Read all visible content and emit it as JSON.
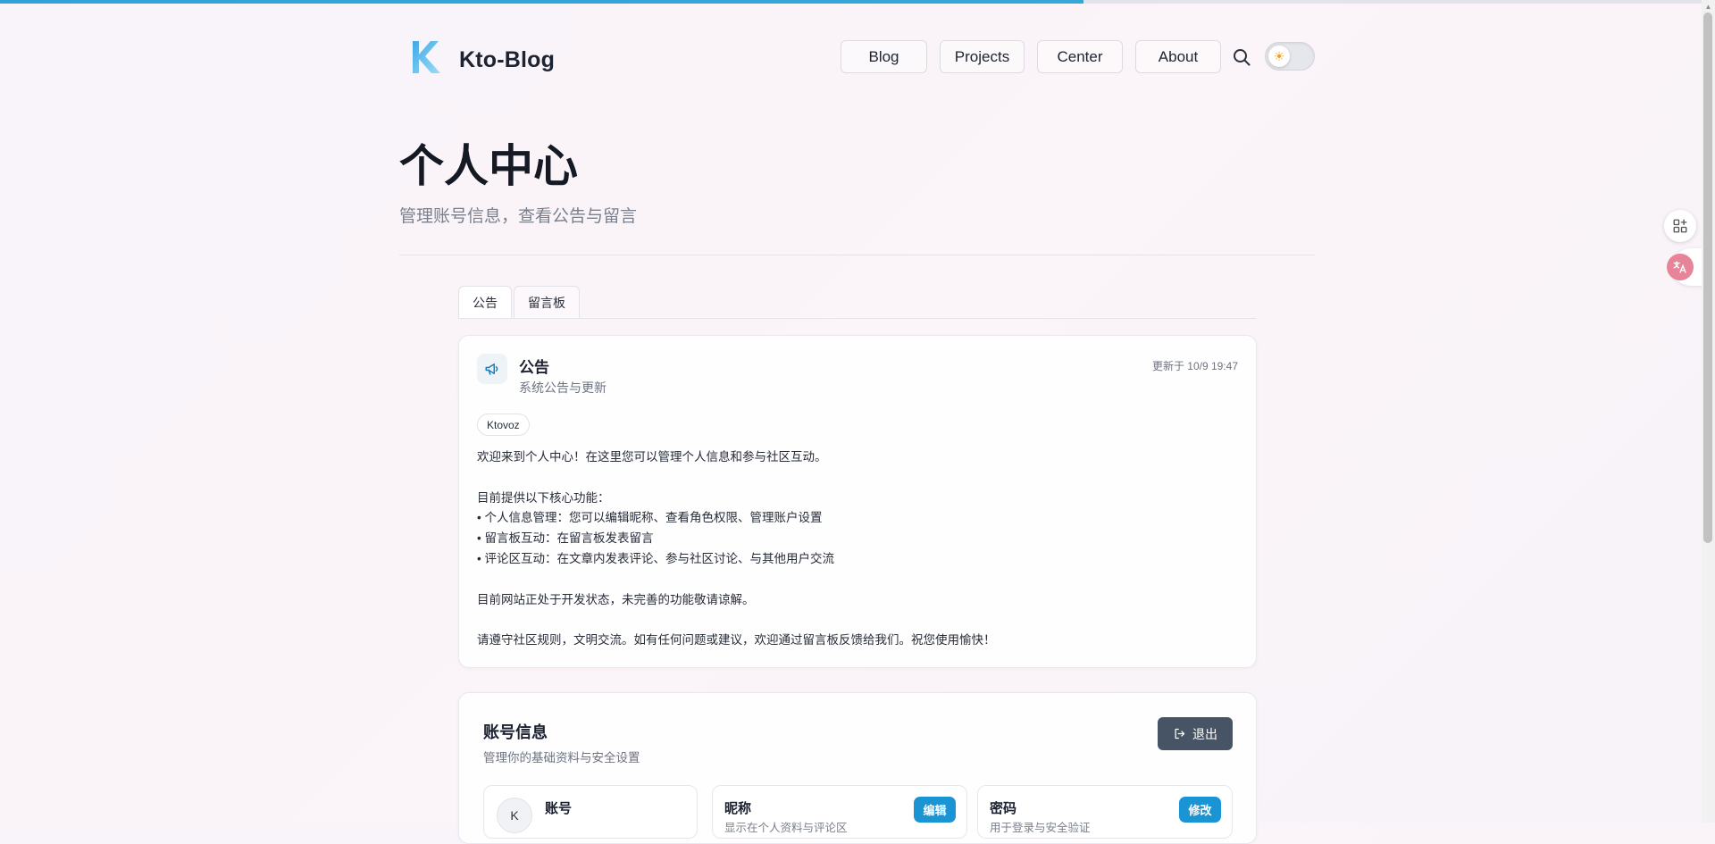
{
  "progress": {
    "fraction": 0.632
  },
  "header": {
    "site_title": "Kto-Blog",
    "nav": [
      {
        "label": "Blog"
      },
      {
        "label": "Projects"
      },
      {
        "label": "Center"
      },
      {
        "label": "About"
      }
    ],
    "theme_icon": "sun-icon"
  },
  "page": {
    "title": "个人中心",
    "subtitle": "管理账号信息，查看公告与留言"
  },
  "tabs": [
    {
      "label": "公告",
      "active": true
    },
    {
      "label": "留言板",
      "active": false
    }
  ],
  "announcement": {
    "title": "公告",
    "subtitle": "系统公告与更新",
    "updated": "更新于 10/9 19:47",
    "author": "Ktovoz",
    "lines": [
      "欢迎来到个人中心！在这里您可以管理个人信息和参与社区互动。",
      "",
      "目前提供以下核心功能：",
      "• 个人信息管理：您可以编辑昵称、查看角色权限、管理账户设置",
      "• 留言板互动：在留言板发表留言",
      "• 评论区互动：在文章内发表评论、参与社区讨论、与其他用户交流",
      "",
      "目前网站正处于开发状态，未完善的功能敬请谅解。",
      "",
      "请遵守社区规则，文明交流。如有任何问题或建议，欢迎通过留言板反馈给我们。祝您使用愉快！"
    ]
  },
  "account": {
    "title": "账号信息",
    "subtitle": "管理你的基础资料与安全设置",
    "logout_label": "退出",
    "avatar_letter": "K",
    "account_label": "账号",
    "nickname_label": "昵称",
    "nickname_desc": "显示在个人资料与评论区",
    "nickname_button": "编辑",
    "password_label": "密码",
    "password_desc": "用于登录与安全验证",
    "password_button": "修改"
  },
  "colors": {
    "accent": "#1b94d4",
    "progress": "#2fa3d8",
    "logout_bg": "#475465",
    "translate_bg": "#e7849a"
  },
  "floating": {
    "apps_icon": "apps-plus-icon",
    "translate_icon": "translate-icon"
  }
}
